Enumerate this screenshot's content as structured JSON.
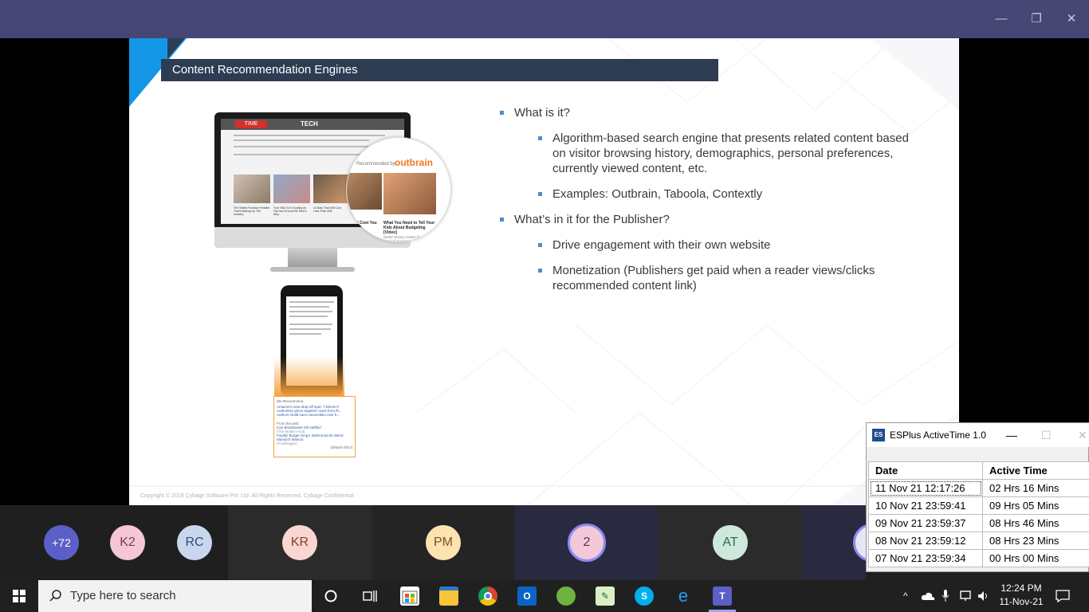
{
  "teams_window": {
    "minimize_glyph": "—",
    "restore_glyph": "❐",
    "close_glyph": "✕"
  },
  "slide": {
    "title": "Content Recommendation Engines",
    "bullets": [
      {
        "text": "What is it?",
        "sub": [
          "Algorithm-based search engine that presents related content based on visitor browsing history, demographics, personal preferences, currently viewed content, etc.",
          "Examples: Outbrain, Taboola, Contextly"
        ]
      },
      {
        "text": "What’s in it for the Publisher?",
        "sub": [
          "Drive engagement with their own website",
          "Monetization (Publishers get paid when a reader views/clicks recommended content link)"
        ]
      }
    ],
    "footer": "Copyright © 2018 Cybage Software Pvt. Ltd. All Rights Reserved. Cybage Confidential",
    "monitor": {
      "site_logo": "TIME",
      "site_section": "TECH",
      "recommended_by": "Recommended by",
      "brand": "outbrain",
      "card1_caption": "Will Cost You",
      "card2_caption": "What You Need to Tell Your Kids About Budgeting [Video]",
      "card2_source": "Better Money Habits by Bank of America",
      "thumb_captions": [
        "The Skilled Furniture Retailer That's Making Up The Industry",
        "Your HBO Is It Growing As Fan-fact Ground Be Here's Why",
        "14 Bars That Will Cost Less Than 20$"
      ]
    },
    "phone_card": {
      "header": "We Recommend",
      "items": [
        "Amazon's new drop-off spot: 7-Eleven?",
        "Authorities piece together clues from flt...",
        "Authors Guild sues universities over b..."
      ],
      "web_header": "From the web",
      "web_items": [
        "Can Blockbuster Kill Netflix?",
        "(The Motley Fool)",
        "Finally! Burger King's Dethroned Its Weird Monarch Mascot",
        "(FoxBlogger)"
      ],
      "whats_this": "[What's this?]"
    }
  },
  "participants": [
    {
      "initials": "+72",
      "bg": "#5b5fc7",
      "fg": "#ffffff"
    },
    {
      "initials": "K2",
      "bg": "#f4c6d6",
      "fg": "#7a3a55"
    },
    {
      "initials": "RC",
      "bg": "#c9d7ee",
      "fg": "#2f4a7a"
    },
    {
      "initials": "KR",
      "bg": "#fad6d0",
      "fg": "#8a3b2e"
    },
    {
      "initials": "PM",
      "bg": "#fde3b0",
      "fg": "#7a5418"
    },
    {
      "initials": "2",
      "bg": "#f3c9d9",
      "fg": "#6c2b47"
    },
    {
      "initials": "AT",
      "bg": "#cfe8dc",
      "fg": "#2c6b4f"
    }
  ],
  "taskbar": {
    "search_placeholder": "Type here to search",
    "time": "12:24 PM",
    "date": "11-Nov-21"
  },
  "esplus": {
    "app_icon": "ES",
    "title": "ESPlus ActiveTime 1.0",
    "columns": [
      "Date",
      "Active Time"
    ],
    "rows": [
      [
        "11 Nov 21 12:17:26",
        "02 Hrs  16 Mins"
      ],
      [
        "10 Nov 21 23:59:41",
        "09 Hrs  05 Mins"
      ],
      [
        "09 Nov 21 23:59:37",
        "08 Hrs  46 Mins"
      ],
      [
        "08 Nov 21 23:59:12",
        "08 Hrs  23 Mins"
      ],
      [
        "07 Nov 21 23:59:34",
        "00 Hrs  00 Mins"
      ]
    ]
  }
}
